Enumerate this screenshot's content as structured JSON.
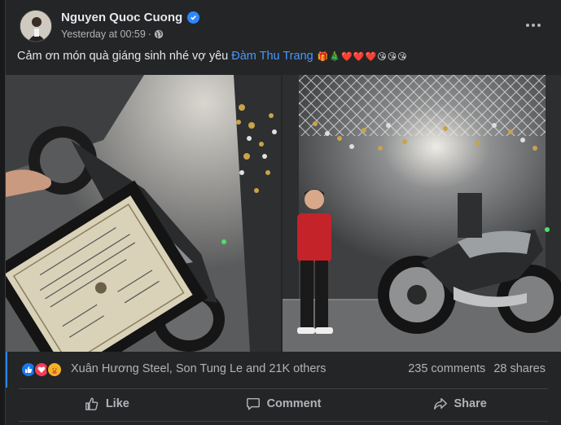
{
  "post": {
    "author": "Nguyen Quoc Cuong",
    "verified": true,
    "timestamp": "Yesterday at 00:59",
    "separator": "·",
    "privacy_icon": "globe-icon",
    "caption_text": "Cảm ơn món quà giáng sinh nhé vợ yêu",
    "mention": "Đàm Thu Trang",
    "emojis": [
      "🎁",
      "🎄",
      "❤️",
      "❤️",
      "❤️",
      "😘",
      "😘",
      "😘"
    ],
    "photos": [
      {
        "name": "photo-certificate-motorcycle",
        "description_icon": "photo"
      },
      {
        "name": "photo-man-with-motorcycle",
        "description_icon": "photo"
      }
    ]
  },
  "reactions": {
    "icons": [
      "like-icon",
      "love-icon",
      "care-icon"
    ],
    "colors": {
      "like": "#1877f2",
      "love": "#f33e58",
      "care": "#f7b125"
    },
    "names_text": "Xuân Hương Steel, Son Tung Le and 21K others",
    "comments": "235 comments",
    "shares": "28 shares"
  },
  "actions": {
    "like_label": "Like",
    "comment_label": "Comment",
    "share_label": "Share"
  }
}
